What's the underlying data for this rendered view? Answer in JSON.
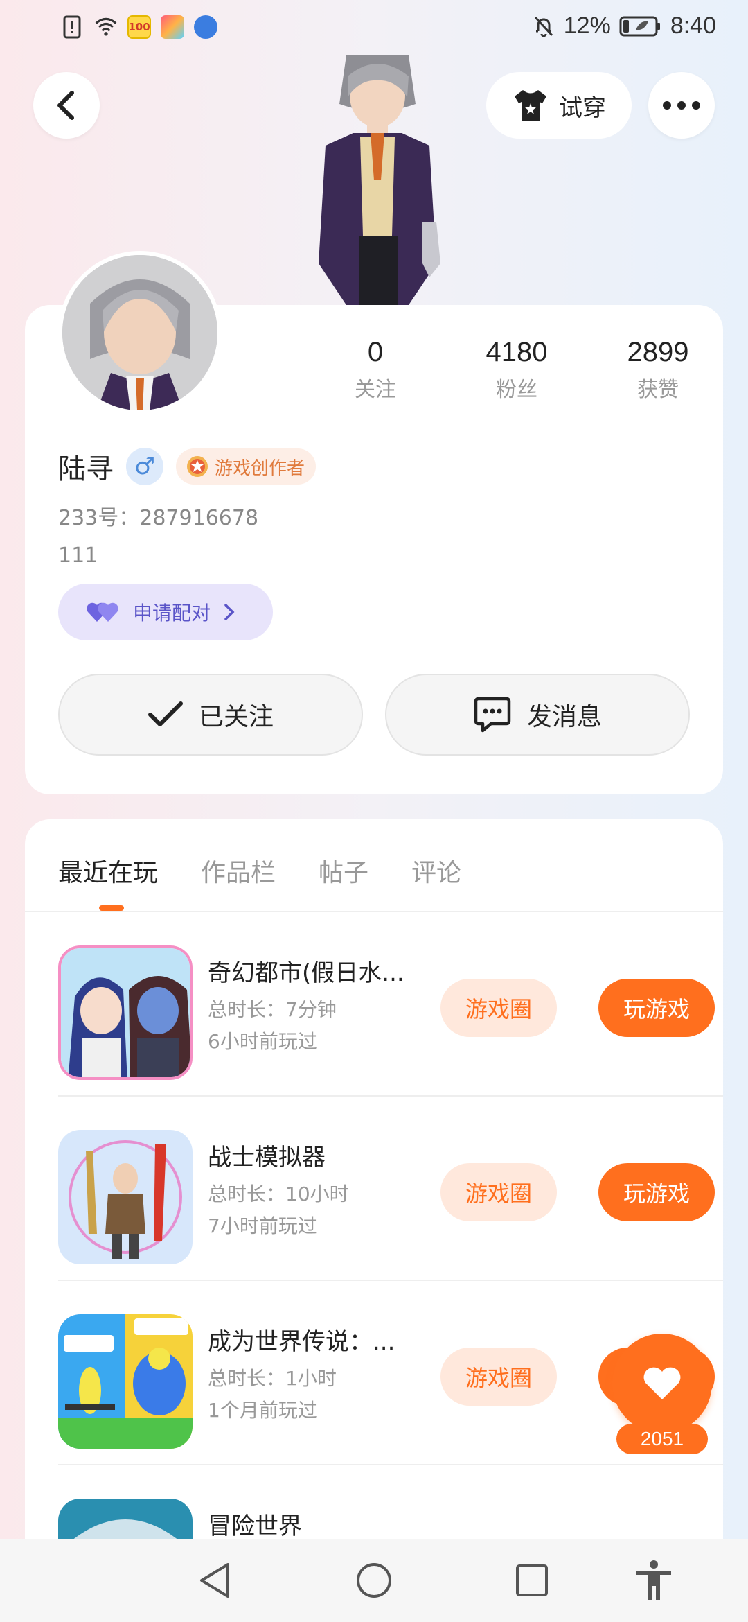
{
  "status_bar": {
    "battery": "12%",
    "time": "8:40",
    "left_icons": [
      "alert-icon",
      "wifi-icon",
      "app-100-icon",
      "app-colorful-icon",
      "app-blue-icon"
    ]
  },
  "header": {
    "try_on_label": "试穿"
  },
  "profile": {
    "name": "陆寻",
    "gender_symbol": "♂",
    "badge": "游戏创作者",
    "uid": "233号：287916678",
    "bio": "111",
    "pair_label": "申请配对",
    "stats": [
      {
        "value": "0",
        "label": "关注"
      },
      {
        "value": "4180",
        "label": "粉丝"
      },
      {
        "value": "2899",
        "label": "获赞"
      }
    ],
    "followed_label": "已关注",
    "message_label": "发消息"
  },
  "tabs": [
    {
      "label": "最近在玩",
      "active": true
    },
    {
      "label": "作品栏",
      "active": false
    },
    {
      "label": "帖子",
      "active": false
    },
    {
      "label": "评论",
      "active": false
    }
  ],
  "games": [
    {
      "title": "奇幻都市(假日水...",
      "duration": "总时长：7分钟",
      "last_played": "6小时前玩过",
      "circle_label": "游戏圈",
      "play_label": "玩游戏"
    },
    {
      "title": "战士模拟器",
      "duration": "总时长：10小时",
      "last_played": "7小时前玩过",
      "circle_label": "游戏圈",
      "play_label": "玩游戏"
    },
    {
      "title": "成为世界传说：...",
      "duration": "总时长：1小时",
      "last_played": "1个月前玩过",
      "circle_label": "游戏圈",
      "play_label": "玩游戏"
    },
    {
      "title": "冒险世界",
      "duration": "",
      "last_played": "",
      "circle_label": "",
      "play_label": ""
    }
  ],
  "like": {
    "count": "2051"
  },
  "colors": {
    "accent": "#ff6f1e",
    "accent_light": "#ffe8dc",
    "pair_bg": "#e8e4fb",
    "pair_text": "#5a54c8"
  }
}
